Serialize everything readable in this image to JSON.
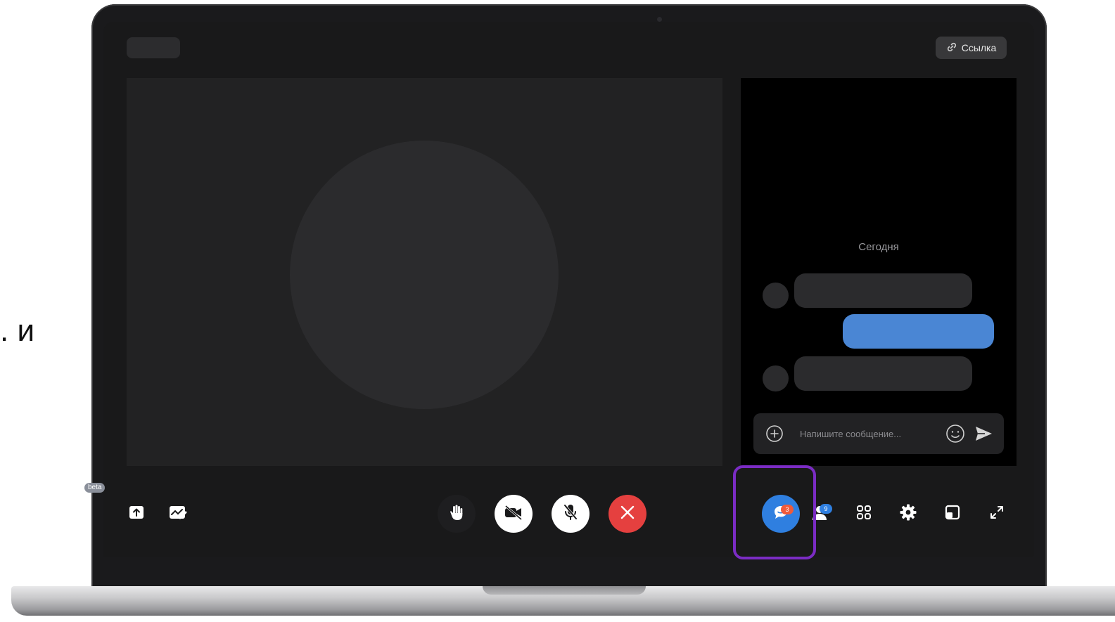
{
  "side_text": ". и",
  "header": {
    "link_label": "Ссылка",
    "link_icon": "link-icon"
  },
  "chat": {
    "date_label": "Сегодня",
    "composer": {
      "placeholder": "Напишите сообщение...",
      "value": ""
    }
  },
  "toolbar": {
    "beta_label": "beta",
    "chat_badge": "3",
    "participants_badge": "9",
    "end_call_color": "#e5403f",
    "chat_color": "#2f7fe0",
    "highlight_color": "#7b2cc4"
  }
}
